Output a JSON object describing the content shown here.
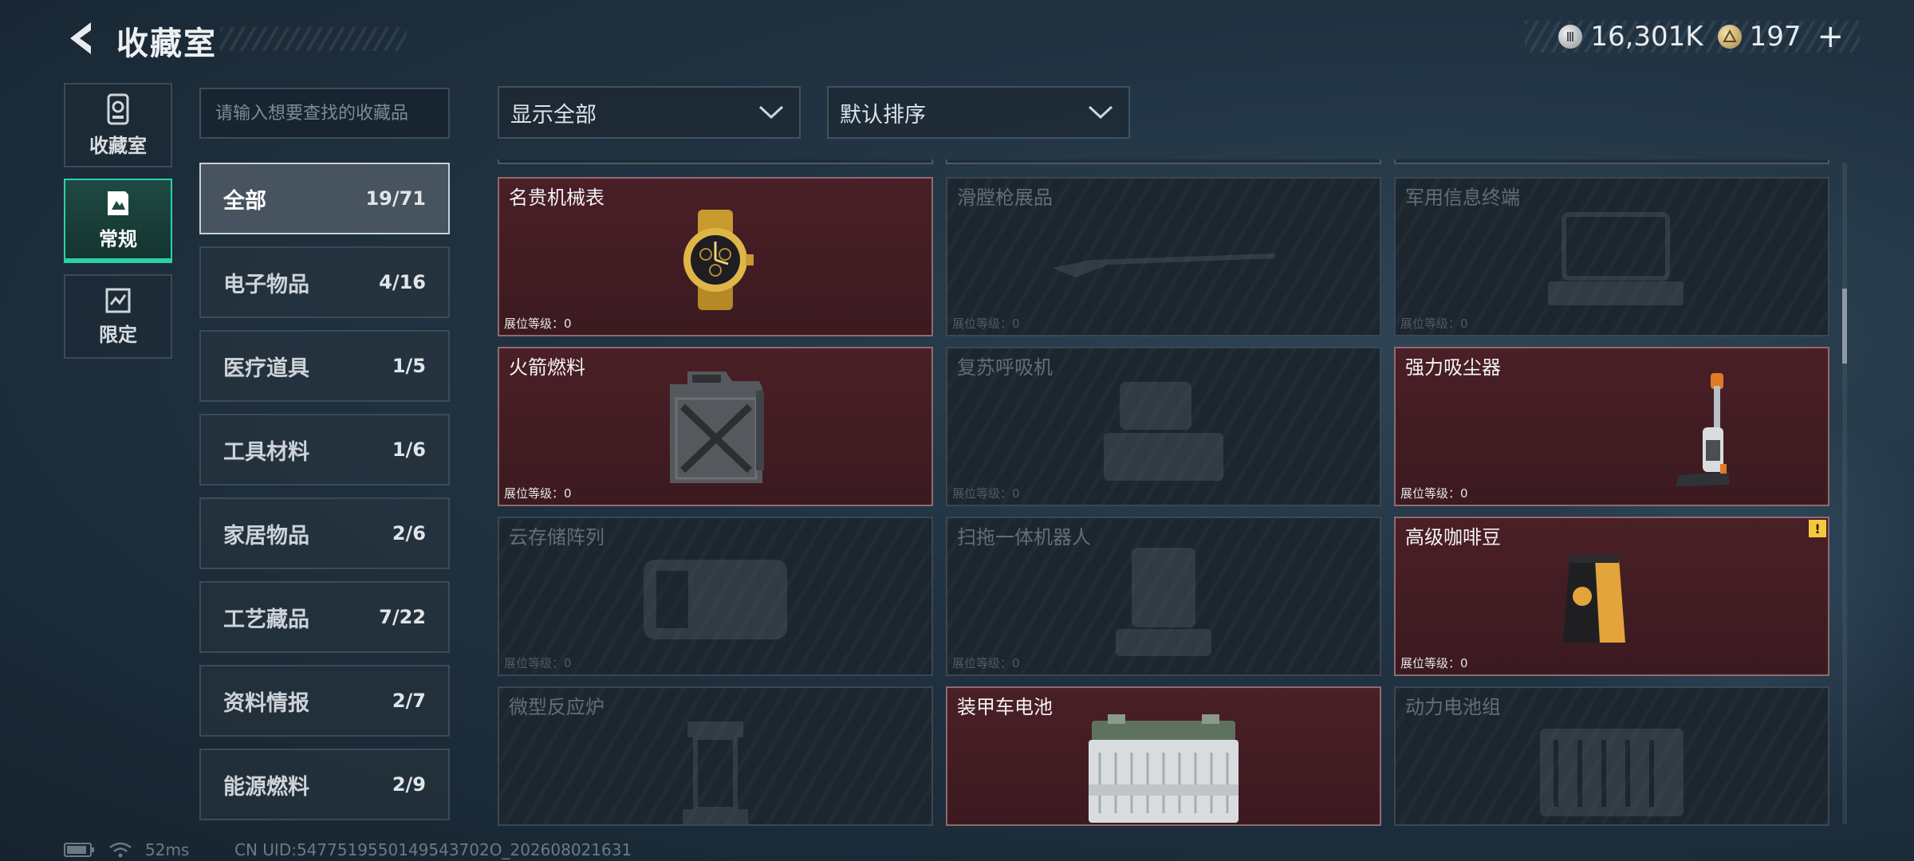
{
  "header": {
    "title": "收藏室",
    "currencies": [
      {
        "name": "silver-coin",
        "value": "16,301K"
      },
      {
        "name": "gold-coin",
        "value": "197"
      }
    ],
    "plus": "+"
  },
  "side_nav": [
    {
      "label": "收藏室",
      "icon": "vault-icon",
      "active": false
    },
    {
      "label": "常规",
      "icon": "collection-icon",
      "active": true
    },
    {
      "label": "限定",
      "icon": "limited-icon",
      "active": false
    }
  ],
  "search": {
    "placeholder": "请输入想要查找的收藏品"
  },
  "categories": [
    {
      "name": "全部",
      "count": "19/71",
      "active": true
    },
    {
      "name": "电子物品",
      "count": "4/16"
    },
    {
      "name": "医疗道具",
      "count": "1/5"
    },
    {
      "name": "工具材料",
      "count": "1/6"
    },
    {
      "name": "家居物品",
      "count": "2/6"
    },
    {
      "name": "工艺藏品",
      "count": "7/22"
    },
    {
      "name": "资料情报",
      "count": "2/7"
    },
    {
      "name": "能源燃料",
      "count": "2/9"
    }
  ],
  "filters": {
    "show": "显示全部",
    "sort": "默认排序"
  },
  "items": [
    {
      "name": "名贵机械表",
      "level": "展位等级：0",
      "owned": true,
      "icon": "watch-icon"
    },
    {
      "name": "滑膛枪展品",
      "level": "展位等级：0",
      "owned": false,
      "icon": "musket-icon"
    },
    {
      "name": "军用信息终端",
      "level": "展位等级：0",
      "owned": false,
      "icon": "terminal-icon"
    },
    {
      "name": "火箭燃料",
      "level": "展位等级：0",
      "owned": true,
      "icon": "fuel-can-icon"
    },
    {
      "name": "复苏呼吸机",
      "level": "展位等级：0",
      "owned": false,
      "icon": "ventilator-icon"
    },
    {
      "name": "强力吸尘器",
      "level": "展位等级：0",
      "owned": true,
      "icon": "vacuum-icon"
    },
    {
      "name": "云存储阵列",
      "level": "展位等级：0",
      "owned": false,
      "icon": "storage-array-icon"
    },
    {
      "name": "扫拖一体机器人",
      "level": "展位等级：0",
      "owned": false,
      "icon": "robot-mop-icon"
    },
    {
      "name": "高级咖啡豆",
      "level": "展位等级：0",
      "owned": true,
      "icon": "coffee-bag-icon",
      "badge": "!"
    },
    {
      "name": "微型反应炉",
      "level": "",
      "owned": false,
      "icon": "reactor-icon"
    },
    {
      "name": "装甲车电池",
      "level": "",
      "owned": true,
      "icon": "battery-icon"
    },
    {
      "name": "动力电池组",
      "level": "",
      "owned": false,
      "icon": "battery-pack-icon"
    }
  ],
  "footer": {
    "ping": "52ms",
    "uid": "CN UID:5477519550149543702O_202608021631"
  },
  "colors": {
    "accent": "#2bd0a8",
    "owned_card": "#4a1f26",
    "badge": "#f5c842"
  }
}
